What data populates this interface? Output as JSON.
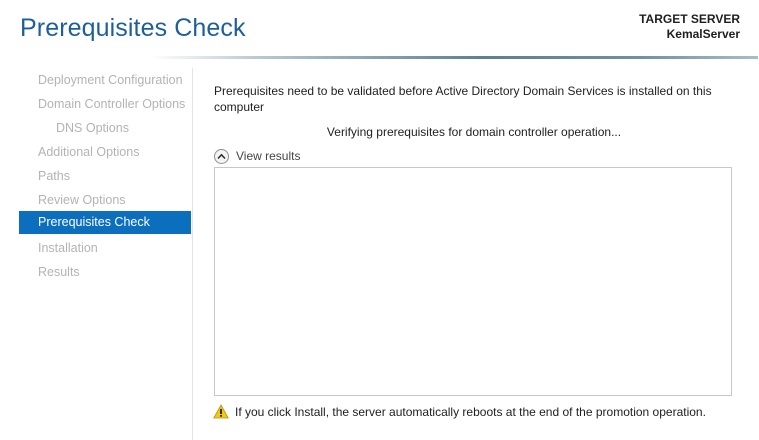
{
  "header": {
    "title": "Prerequisites Check",
    "target_server_label": "TARGET SERVER",
    "target_server_name": "KemalServer"
  },
  "sidebar": {
    "items": [
      {
        "label": "Deployment Configuration",
        "state": "disabled"
      },
      {
        "label": "Domain Controller Options",
        "state": "disabled"
      },
      {
        "label": "DNS Options",
        "state": "disabled"
      },
      {
        "label": "Additional Options",
        "state": "disabled"
      },
      {
        "label": "Paths",
        "state": "disabled"
      },
      {
        "label": "Review Options",
        "state": "disabled"
      },
      {
        "label": "Prerequisites Check",
        "state": "active"
      },
      {
        "label": "Installation",
        "state": "disabled"
      },
      {
        "label": "Results",
        "state": "disabled"
      }
    ]
  },
  "main": {
    "intro": "Prerequisites need to be validated before Active Directory Domain Services is installed on this computer",
    "verifying": "Verifying prerequisites for domain controller operation...",
    "view_results_label": "View results",
    "warning": "If you click Install, the server automatically reboots at the end of the promotion operation."
  },
  "icons": {
    "view_results": "chevron-up-icon",
    "warning": "warning-icon"
  },
  "colors": {
    "title": "#1e5f9a",
    "active_nav_bg": "#0b6fbd",
    "disabled_nav_text": "#b3b3b3",
    "warning_yellow": "#f2c811"
  }
}
